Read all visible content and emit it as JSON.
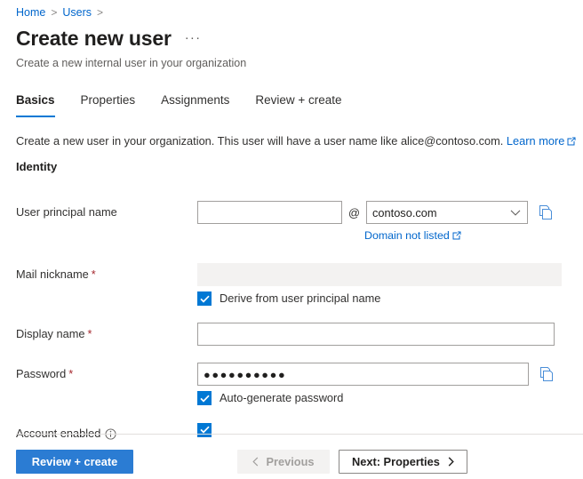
{
  "breadcrumb": {
    "items": [
      {
        "label": "Home"
      },
      {
        "label": "Users"
      }
    ],
    "separator": ">"
  },
  "header": {
    "title": "Create new user",
    "subtitle": "Create a new internal user in your organization",
    "overflow_menu": "···"
  },
  "tabs": [
    {
      "label": "Basics",
      "active": true
    },
    {
      "label": "Properties",
      "active": false
    },
    {
      "label": "Assignments",
      "active": false
    },
    {
      "label": "Review + create",
      "active": false
    }
  ],
  "description": {
    "text": "Create a new user in your organization. This user will have a user name like alice@contoso.com.",
    "link_label": "Learn more"
  },
  "section": {
    "title": "Identity"
  },
  "fields": {
    "upn": {
      "label": "User principal name",
      "value": "",
      "at_symbol": "@",
      "domain_value": "contoso.com",
      "domain_link": "Domain not listed",
      "copy_title": "Copy"
    },
    "mail_nickname": {
      "label": "Mail nickname",
      "required_marker": "*",
      "value": "",
      "checkbox_label": "Derive from user principal name",
      "checked": true
    },
    "display_name": {
      "label": "Display name",
      "required_marker": "*",
      "value": ""
    },
    "password": {
      "label": "Password",
      "required_marker": "*",
      "value": "●●●●●●●●●●",
      "checkbox_label": "Auto-generate password",
      "checked": true,
      "copy_title": "Copy"
    },
    "account_enabled": {
      "label": "Account enabled",
      "checked": true,
      "info_title": "Info"
    }
  },
  "footer": {
    "review_create": "Review + create",
    "previous": "Previous",
    "next": "Next: Properties"
  },
  "colors": {
    "accent": "#0078d4",
    "primary_button": "#2b7cd3",
    "link": "#0066cc",
    "required": "#a4262c",
    "disabled_bg": "#f3f2f1"
  }
}
